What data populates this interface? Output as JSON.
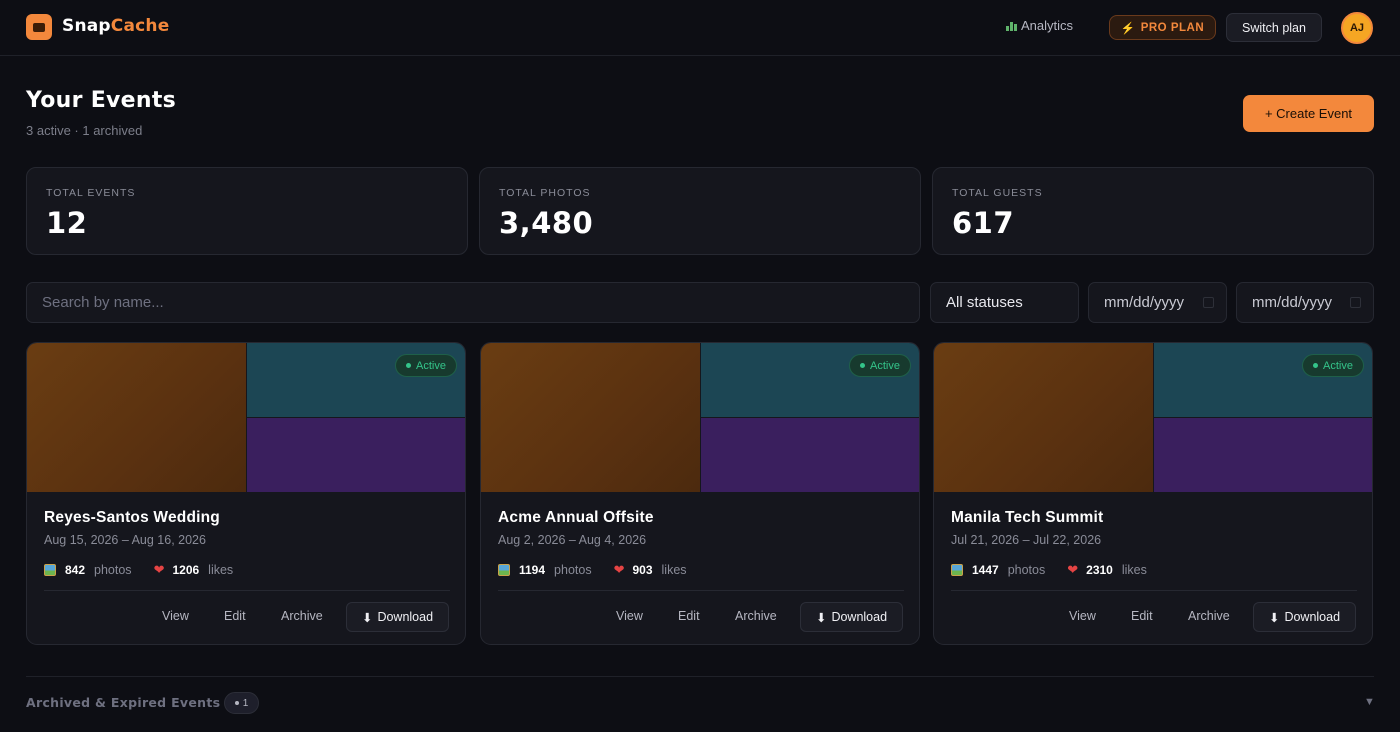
{
  "header": {
    "brand_part1": "Snap",
    "brand_part2": "Cache",
    "nav_analytics": "Analytics",
    "plan_badge": "PRO PLAN",
    "switch_plan": "Switch plan",
    "avatar_initials": "AJ"
  },
  "page": {
    "title": "Your Events",
    "subtitle": "3 active · 1 archived",
    "create_button": "+ Create Event"
  },
  "stats": [
    {
      "label": "TOTAL EVENTS",
      "value": "12"
    },
    {
      "label": "TOTAL PHOTOS",
      "value": "3,480"
    },
    {
      "label": "TOTAL GUESTS",
      "value": "617"
    }
  ],
  "filters": {
    "search_placeholder": "Search by name...",
    "status_value": "All statuses",
    "date_from_placeholder": "mm/dd/yyyy",
    "date_to_placeholder": "mm/dd/yyyy"
  },
  "events": [
    {
      "name": "Reyes-Santos Wedding",
      "dates": "Aug 15, 2026 – Aug 16, 2026",
      "status": "Active",
      "photos": "842",
      "likes": "1206"
    },
    {
      "name": "Acme Annual Offsite",
      "dates": "Aug 2, 2026 – Aug 4, 2026",
      "status": "Active",
      "photos": "1194",
      "likes": "903"
    },
    {
      "name": "Manila Tech Summit",
      "dates": "Jul 21, 2026 – Jul 22, 2026",
      "status": "Active",
      "photos": "1447",
      "likes": "2310"
    }
  ],
  "labels": {
    "photos_unit": "photos",
    "likes_unit": "likes",
    "view": "View",
    "edit": "Edit",
    "archive": "Archive",
    "download": "Download"
  },
  "archived": {
    "label": "Archived & Expired Events",
    "count": "1"
  },
  "colors": {
    "accent": "#f3883c",
    "background": "#0d0e14",
    "card": "#15161d",
    "active_green": "#34c48a"
  },
  "icons": [
    "camera-logo-icon",
    "bar-chart-icon",
    "lightning-icon",
    "calendar-icon",
    "photo-icon",
    "heart-icon",
    "download-icon",
    "chevron-down-icon"
  ]
}
